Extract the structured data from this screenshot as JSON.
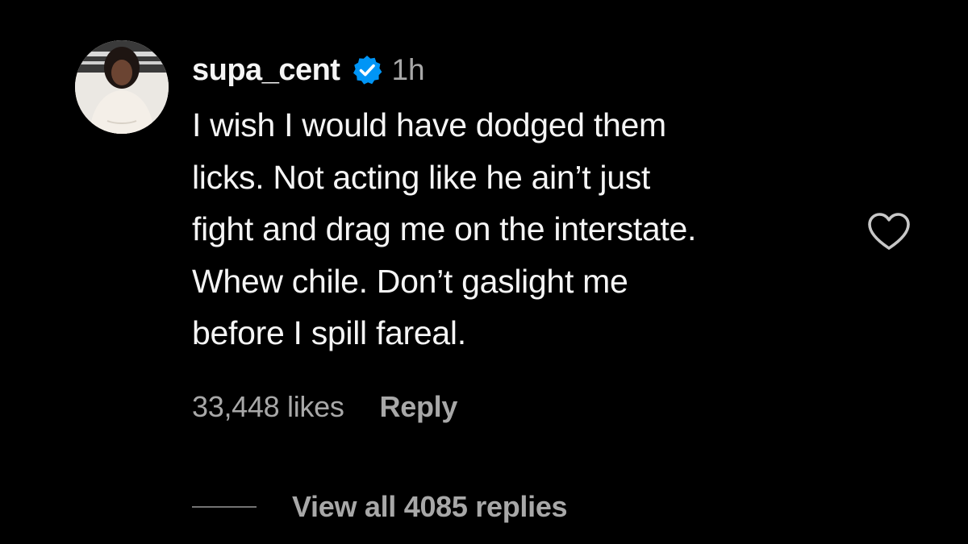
{
  "comment": {
    "avatar": {
      "icon": "profile-photo",
      "alt": "supa_cent"
    },
    "username": "supa_cent",
    "verified_icon": "verified-badge-icon",
    "timestamp": "1h",
    "body_lines": [
      "I wish I would have dodged them",
      "licks. Not acting like he ain’t just",
      "fight and drag me on the interstate.",
      "Whew chile. Don’t gaslight me",
      "before I spill fareal."
    ],
    "like_icon": "heart-outline-icon",
    "likes_text": "33,448 likes",
    "reply_label": "Reply",
    "view_replies_label": "View all 4085 replies"
  },
  "colors": {
    "background": "#000000",
    "primary_text": "#f5f5f5",
    "secondary_text": "#a8a8a8",
    "verified_blue": "#0095f6",
    "divider": "#737373"
  }
}
